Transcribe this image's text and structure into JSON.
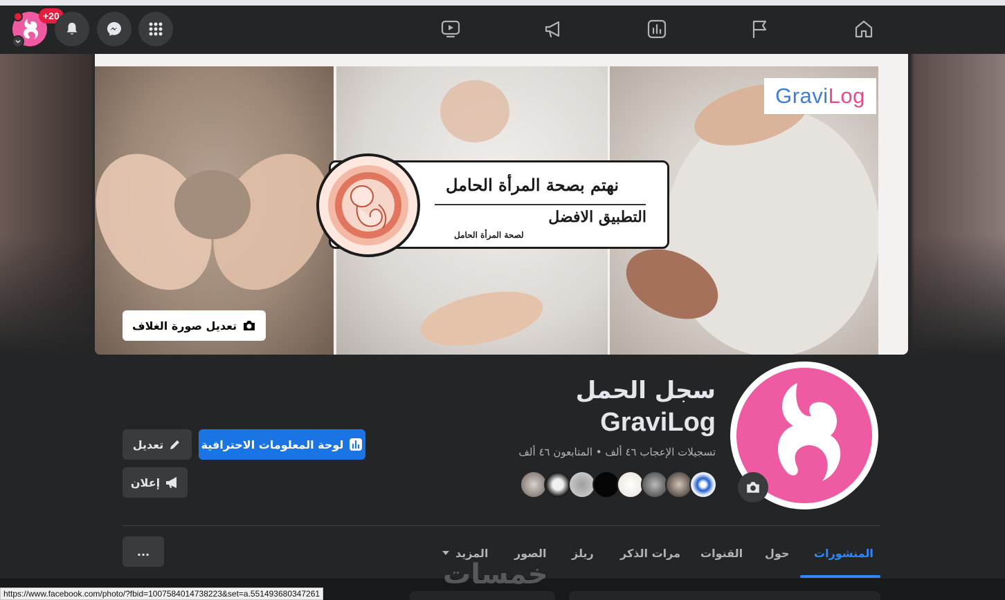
{
  "topbar": {
    "notification_badge": "+20",
    "icons": [
      "bell-icon",
      "messenger-icon",
      "apps-grid-icon",
      "video-icon",
      "megaphone-icon",
      "insights-icon",
      "flag-icon",
      "home-icon"
    ]
  },
  "cover": {
    "banner_line1": "نهتم بصحة المرأة الحامل",
    "banner_line2": "التطبيق الافضل",
    "banner_line3": "لصحة المرأة الحامل",
    "logo_prefix": "Gravi",
    "logo_suffix": "Log",
    "edit_cover_label": "تعديل صورة الغلاف"
  },
  "profile": {
    "title_ar": "سجل الحمل",
    "title_en": "GraviLog",
    "stats": "تسجيلات الإعجاب ٤٦ ألف • المتابعون ٤٦ ألف"
  },
  "actions": {
    "dashboard_label": "لوحة المعلومات الاحترافية",
    "edit_label": "تعديل",
    "ad_label": "إعلان",
    "more_label": "..."
  },
  "tabs": {
    "posts": "المنشورات",
    "about": "حول",
    "channels": "القنوات",
    "mentions": "مرات الذكر",
    "reels": "ريلز",
    "photos": "الصور",
    "more": "المزيد"
  },
  "watermark": "خمسات",
  "status_url": "https://www.facebook.com/photo/?fbid=1007584014738223&set=a.551493680347261",
  "colors": {
    "accent": "#1b74e4",
    "brand_pink": "#ee5ba2",
    "badge_red": "#e41e3f",
    "logo_blue": "#3b7dd8"
  }
}
